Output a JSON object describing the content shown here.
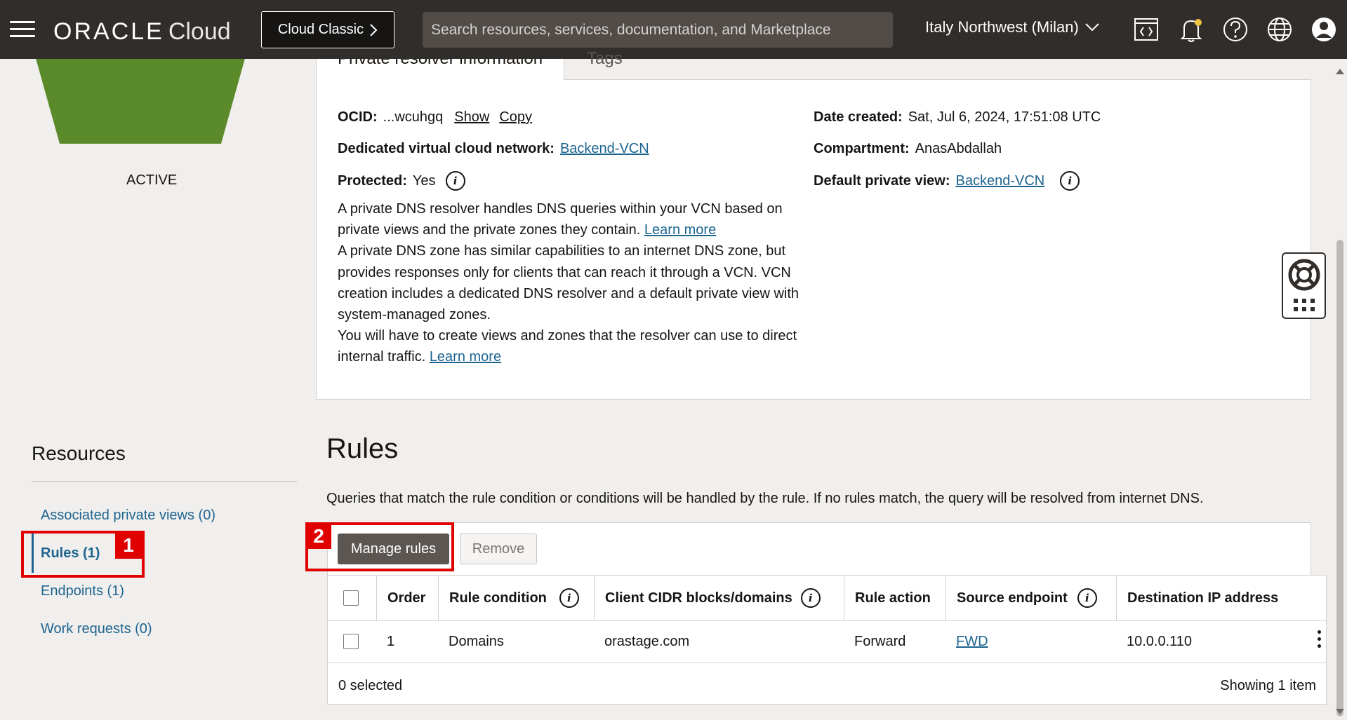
{
  "topbar": {
    "brand": "ORACLE",
    "product": "Cloud",
    "classic_button": "Cloud Classic",
    "search_placeholder": "Search resources, services, documentation, and Marketplace",
    "region": "Italy Northwest (Milan)"
  },
  "resolver": {
    "status": "ACTIVE",
    "tabs": [
      "Private resolver information",
      "Tags"
    ],
    "ocid_label": "OCID:",
    "ocid_value": "...wcuhgq",
    "show_link": "Show",
    "copy_link": "Copy",
    "vcn_label": "Dedicated virtual cloud network:",
    "vcn_value": "Backend-VCN",
    "protected_label": "Protected:",
    "protected_value": "Yes",
    "date_label": "Date created:",
    "date_value": "Sat, Jul 6, 2024, 17:51:08 UTC",
    "compartment_label": "Compartment:",
    "compartment_value": "AnasAbdallah",
    "default_view_label": "Default private view:",
    "default_view_value": "Backend-VCN",
    "desc1": "A private DNS resolver handles DNS queries within your VCN based on private views and the private zones they contain.",
    "desc2": "A private DNS zone has similar capabilities to an internet DNS zone, but provides responses only for clients that can reach it through a VCN. VCN creation includes a dedicated DNS resolver and a default private view with system-managed zones.",
    "desc3": "You will have to create views and zones that the resolver can use to direct internal traffic.",
    "learn_more": "Learn more"
  },
  "resources": {
    "title": "Resources",
    "items": [
      {
        "label": "Associated private views (0)"
      },
      {
        "label": "Rules (1)"
      },
      {
        "label": "Endpoints (1)"
      },
      {
        "label": "Work requests (0)"
      }
    ]
  },
  "annotations": [
    "1",
    "2"
  ],
  "rules": {
    "title": "Rules",
    "description": "Queries that match the rule condition or conditions will be handled by the rule. If no rules match, the query will be resolved from internet DNS.",
    "manage_button": "Manage rules",
    "remove_button": "Remove",
    "columns": [
      "Order",
      "Rule condition",
      "Client CIDR blocks/domains",
      "Rule action",
      "Source endpoint",
      "Destination IP address"
    ],
    "rows": [
      {
        "order": "1",
        "condition": "Domains",
        "client": "orastage.com",
        "action": "Forward",
        "source": "FWD",
        "destination": "10.0.0.110"
      }
    ],
    "selected_text": "0 selected",
    "showing_text": "Showing 1 item"
  }
}
